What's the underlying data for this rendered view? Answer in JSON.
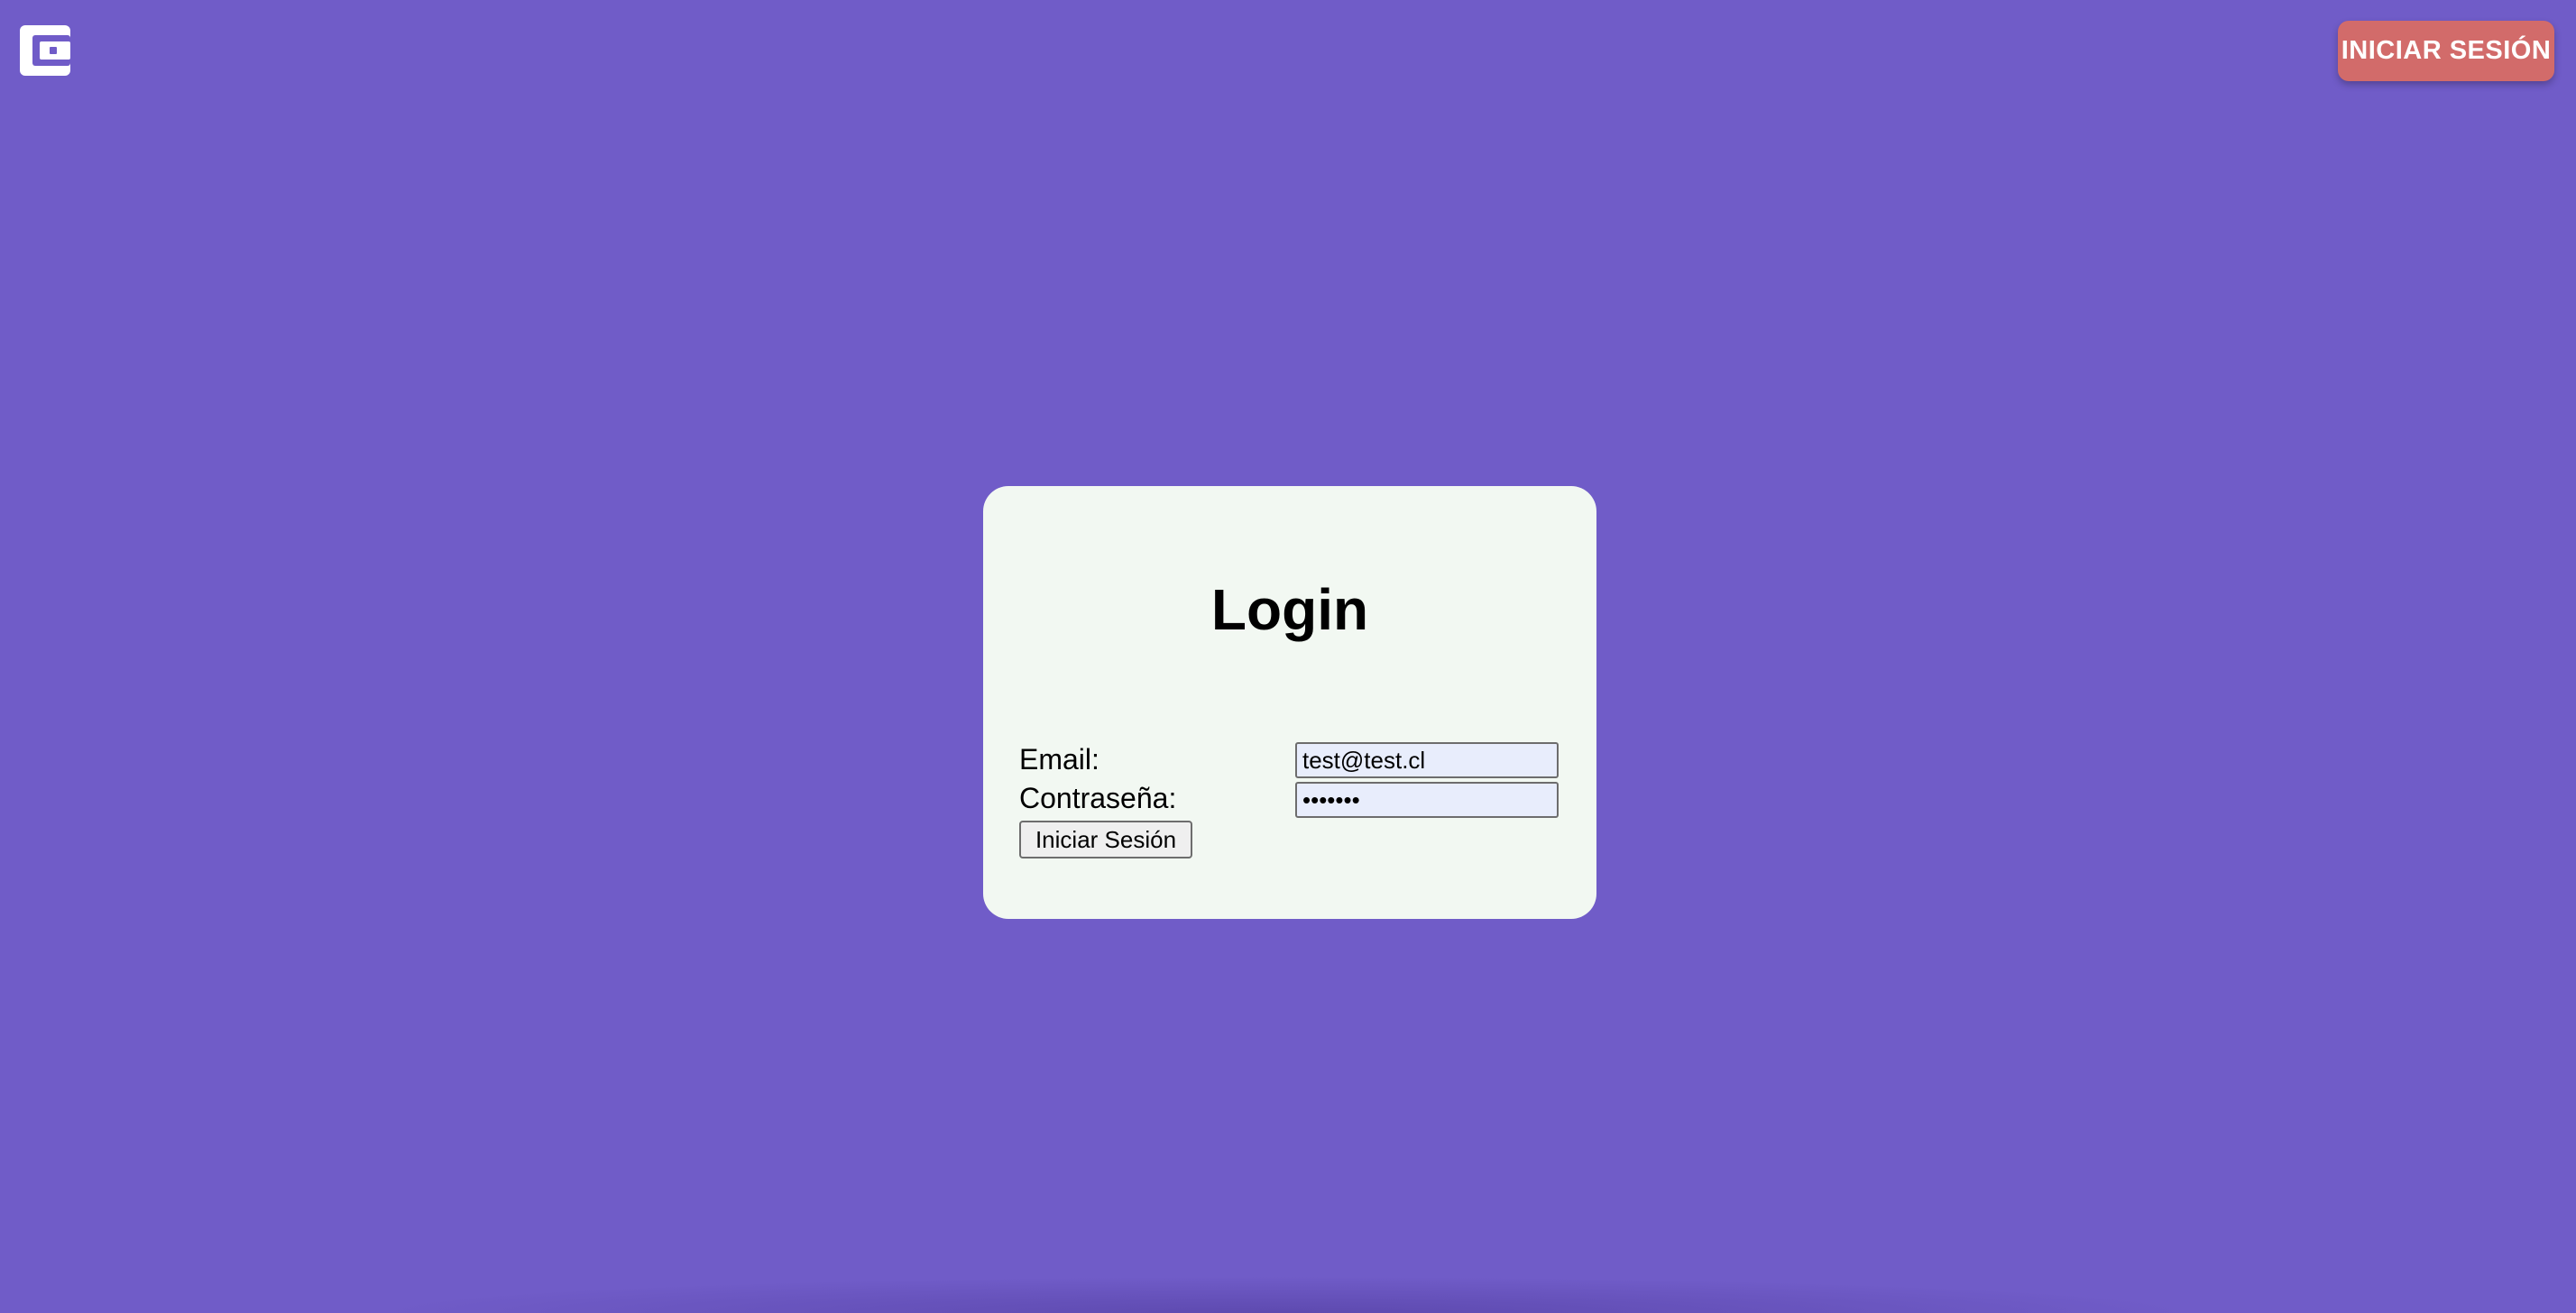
{
  "header": {
    "logo_icon": "wallet-icon",
    "login_button_label": "INICIAR SESIÓN"
  },
  "login_form": {
    "title": "Login",
    "email_label": "Email:",
    "email_value": "test@test.cl",
    "password_label": "Contraseña:",
    "password_value": "1234567",
    "submit_label": "Iniciar Sesión"
  },
  "colors": {
    "background": "#705cc8",
    "card_background": "#f2f8f2",
    "header_button": "#d26b6a",
    "input_autofill": "#e8edfc"
  }
}
